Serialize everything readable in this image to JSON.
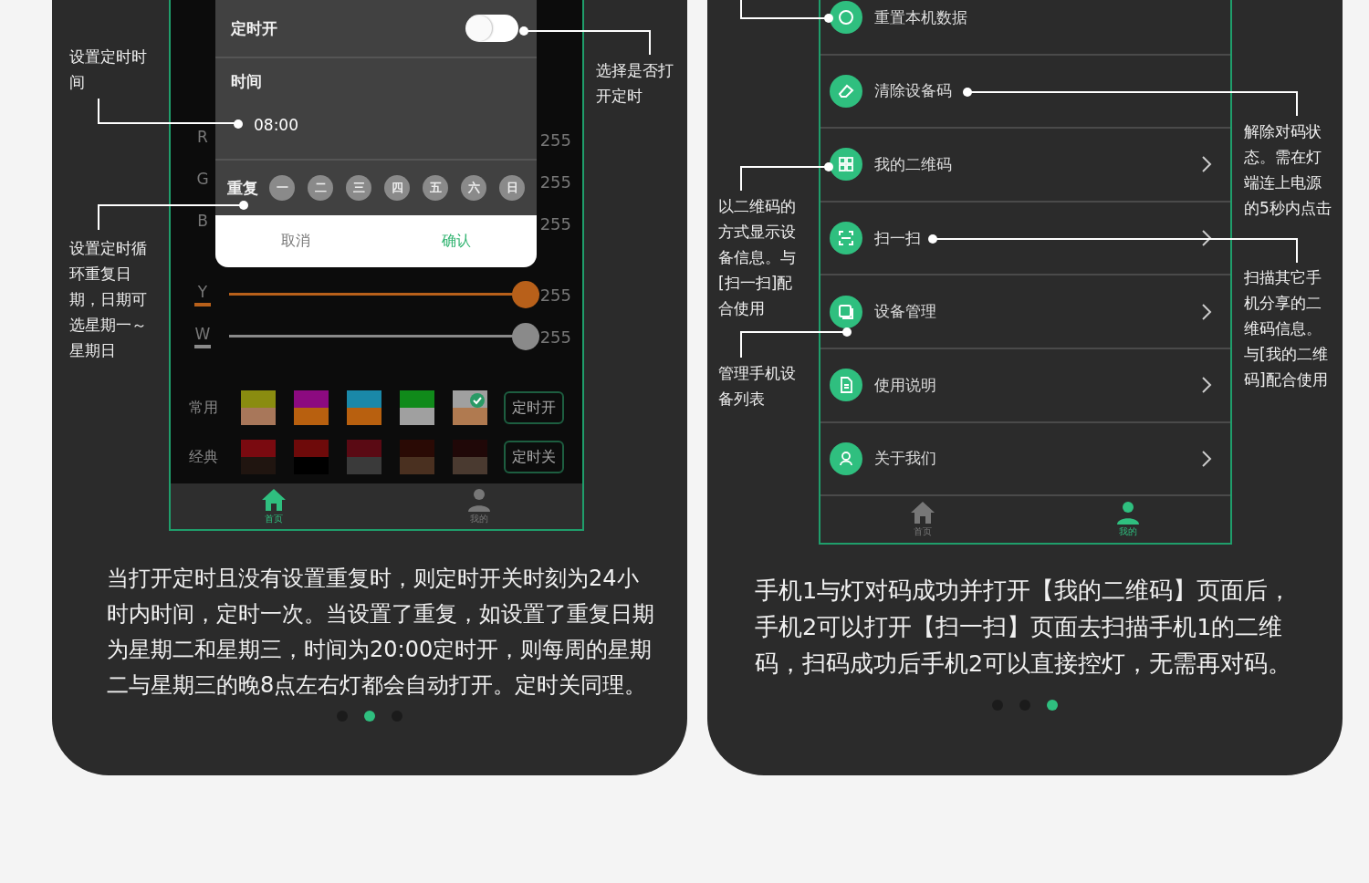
{
  "timer_panel": {
    "annotations": [
      "设置定时时间",
      "选择是否打开定时",
      "设置定时循环重复日期，日期可选星期一～星期日"
    ],
    "dialog": {
      "switch_label": "定时开",
      "switch_on": false,
      "time_label": "时间",
      "time_value": "08:00",
      "repeat_label": "重复",
      "weekdays": [
        {
          "label": "一",
          "selected": false
        },
        {
          "label": "二",
          "selected": false
        },
        {
          "label": "三",
          "selected": false
        },
        {
          "label": "四",
          "selected": false
        },
        {
          "label": "五",
          "selected": false
        },
        {
          "label": "六",
          "selected": false
        },
        {
          "label": "日",
          "selected": false
        }
      ],
      "cancel": "取消",
      "confirm": "确认"
    },
    "channels": [
      {
        "name": "R",
        "reading": "255"
      },
      {
        "name": "G",
        "reading": "255"
      },
      {
        "name": "B",
        "reading": "255"
      },
      {
        "name": "Y",
        "reading": "255",
        "level": 1,
        "color": "#b8601a"
      },
      {
        "name": "W",
        "reading": "255",
        "level": 1,
        "color": "#8a8a8a"
      }
    ],
    "presets": [
      {
        "label": "常用",
        "button": "定时开",
        "swatches": [
          {
            "bands": [
              {
                "color": "#8a8c10"
              },
              {
                "color": "#a8775a"
              }
            ],
            "selected": false
          },
          {
            "bands": [
              {
                "color": "#8c0a80"
              },
              {
                "color": "#b8600f"
              }
            ],
            "selected": false
          },
          {
            "bands": [
              {
                "color": "#1a88a8"
              },
              {
                "color": "#b8600f"
              }
            ],
            "selected": false
          },
          {
            "bands": [
              {
                "color": "#108a1a"
              },
              {
                "color": "#a0a0a0"
              }
            ],
            "selected": false
          },
          {
            "bands": [
              {
                "color": "#a0a0a0"
              },
              {
                "color": "#b07a50"
              }
            ],
            "selected": true
          }
        ]
      },
      {
        "label": "经典",
        "button": "定时关",
        "swatches": [
          {
            "bands": [
              {
                "color": "#7a0a10"
              },
              {
                "color": "#201510"
              }
            ],
            "selected": false
          },
          {
            "bands": [
              {
                "color": "#6e0a0a"
              },
              {
                "color": "#000000"
              }
            ],
            "selected": false
          },
          {
            "bands": [
              {
                "color": "#5a0a14"
              },
              {
                "color": "#3a3a3a"
              }
            ],
            "selected": false
          },
          {
            "bands": [
              {
                "color": "#2a0a05"
              },
              {
                "color": "#4a3020"
              }
            ],
            "selected": false
          },
          {
            "bands": [
              {
                "color": "#200808"
              },
              {
                "color": "#4a3a30"
              }
            ],
            "selected": false
          }
        ]
      }
    ],
    "nav": [
      {
        "label": "首页",
        "selected": true
      },
      {
        "label": "我的",
        "selected": false
      }
    ],
    "description": "当打开定时且没有设置重复时，则定时开关时刻为24小时内时间，定时一次。当设置了重复，如设置了重复日期为星期二和星期三，时间为20:00定时开，则每周的星期二与星期三的晚8点左右灯都会自动打开。定时关同理。",
    "pager": [
      {
        "selected": false
      },
      {
        "selected": true
      },
      {
        "selected": false
      }
    ]
  },
  "menu_panel": {
    "annotations": [
      "以二维码的方式显示设备信息。与[扫一扫]配合使用",
      "管理手机设备列表",
      "解除对码状态。需在灯端连上电源的5秒内点击",
      "扫描其它手机分享的二维码信息。与[我的二维码]配合使用"
    ],
    "items": [
      {
        "label": "重置本机数据",
        "chevron": false
      },
      {
        "label": "清除设备码",
        "chevron": false
      },
      {
        "label": "我的二维码",
        "chevron": true
      },
      {
        "label": "扫一扫",
        "chevron": true
      },
      {
        "label": "设备管理",
        "chevron": true
      },
      {
        "label": "使用说明",
        "chevron": true
      },
      {
        "label": "关于我们",
        "chevron": true
      }
    ],
    "nav": [
      {
        "label": "首页",
        "selected": false
      },
      {
        "label": "我的",
        "selected": true
      }
    ],
    "description": "手机1与灯对码成功并打开【我的二维码】页面后，手机2可以打开【扫一扫】页面去扫描手机1的二维码，扫码成功后手机2可以直接控灯，无需再对码。",
    "pager": [
      {
        "selected": false
      },
      {
        "selected": false
      },
      {
        "selected": true
      }
    ]
  }
}
